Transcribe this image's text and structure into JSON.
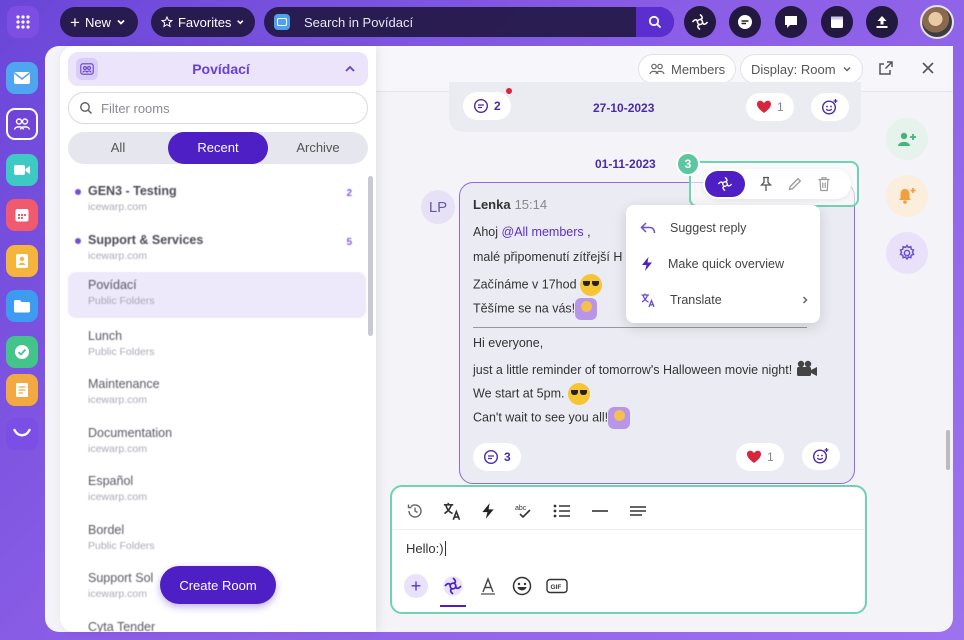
{
  "topbar": {
    "new_label": "New",
    "favorites_label": "Favorites",
    "search_placeholder": "Search in Povídací"
  },
  "rooms_panel": {
    "title": "Povídací",
    "filter_placeholder": "Filter rooms",
    "tabs": [
      "All",
      "Recent",
      "Archive"
    ],
    "active_tab": "Recent",
    "rooms": [
      {
        "name": "GEN3 - Testing",
        "sub": "icewarp.com",
        "badge": "2",
        "unread": true
      },
      {
        "name": "Support & Services",
        "sub": "icewarp.com",
        "badge": "5",
        "unread": true
      },
      {
        "name": "Povídací",
        "sub": "Public Folders",
        "badge": "",
        "unread": false
      },
      {
        "name": "Lunch",
        "sub": "Public Folders",
        "badge": "",
        "unread": false
      },
      {
        "name": "Maintenance",
        "sub": "icewarp.com",
        "badge": "",
        "unread": false
      },
      {
        "name": "Documentation",
        "sub": "icewarp.com",
        "badge": "",
        "unread": false
      },
      {
        "name": "Español",
        "sub": "icewarp.com",
        "badge": "",
        "unread": false
      },
      {
        "name": "Bordel",
        "sub": "Public Folders",
        "badge": "",
        "unread": false
      },
      {
        "name": "Support Sol",
        "sub": "icewarp.com",
        "badge": "",
        "unread": false
      },
      {
        "name": "Cyta Tender",
        "sub": "",
        "badge": "",
        "unread": false
      }
    ],
    "create_room_label": "Create Room"
  },
  "chat_header": {
    "members_label": "Members",
    "display_label": "Display: Room"
  },
  "previous_message": {
    "date": "27-10-2023",
    "comments_count": "2",
    "reactions_count": "1"
  },
  "message": {
    "date": "01-11-2023",
    "author_initials": "LP",
    "author": "Lenka",
    "time": "15:14",
    "lines": [
      {
        "text": "Ahoj ",
        "mention": "@All members",
        "tail": " ,"
      },
      {
        "text": "malé připomenutí zítřejší H"
      },
      {
        "text": "Začínáme v 17hod"
      },
      {
        "text": "Těšíme se na vás!"
      },
      {
        "text": "Hi everyone,"
      },
      {
        "text": "just a little reminder of tomorrow's Halloween movie night!"
      },
      {
        "text": "We start at 5pm."
      },
      {
        "text": "Can't wait to see you all!"
      }
    ],
    "comments_count": "3",
    "reactions_count": "1"
  },
  "hover_toolbar": {
    "step_number": "3"
  },
  "ai_menu": {
    "items": [
      "Suggest reply",
      "Make quick overview",
      "Translate"
    ]
  },
  "composer": {
    "input_value": "Hello:)"
  },
  "colors": {
    "accent": "#4d1fc4",
    "highlight": "#6fd3b0",
    "heart": "#d8243c"
  }
}
